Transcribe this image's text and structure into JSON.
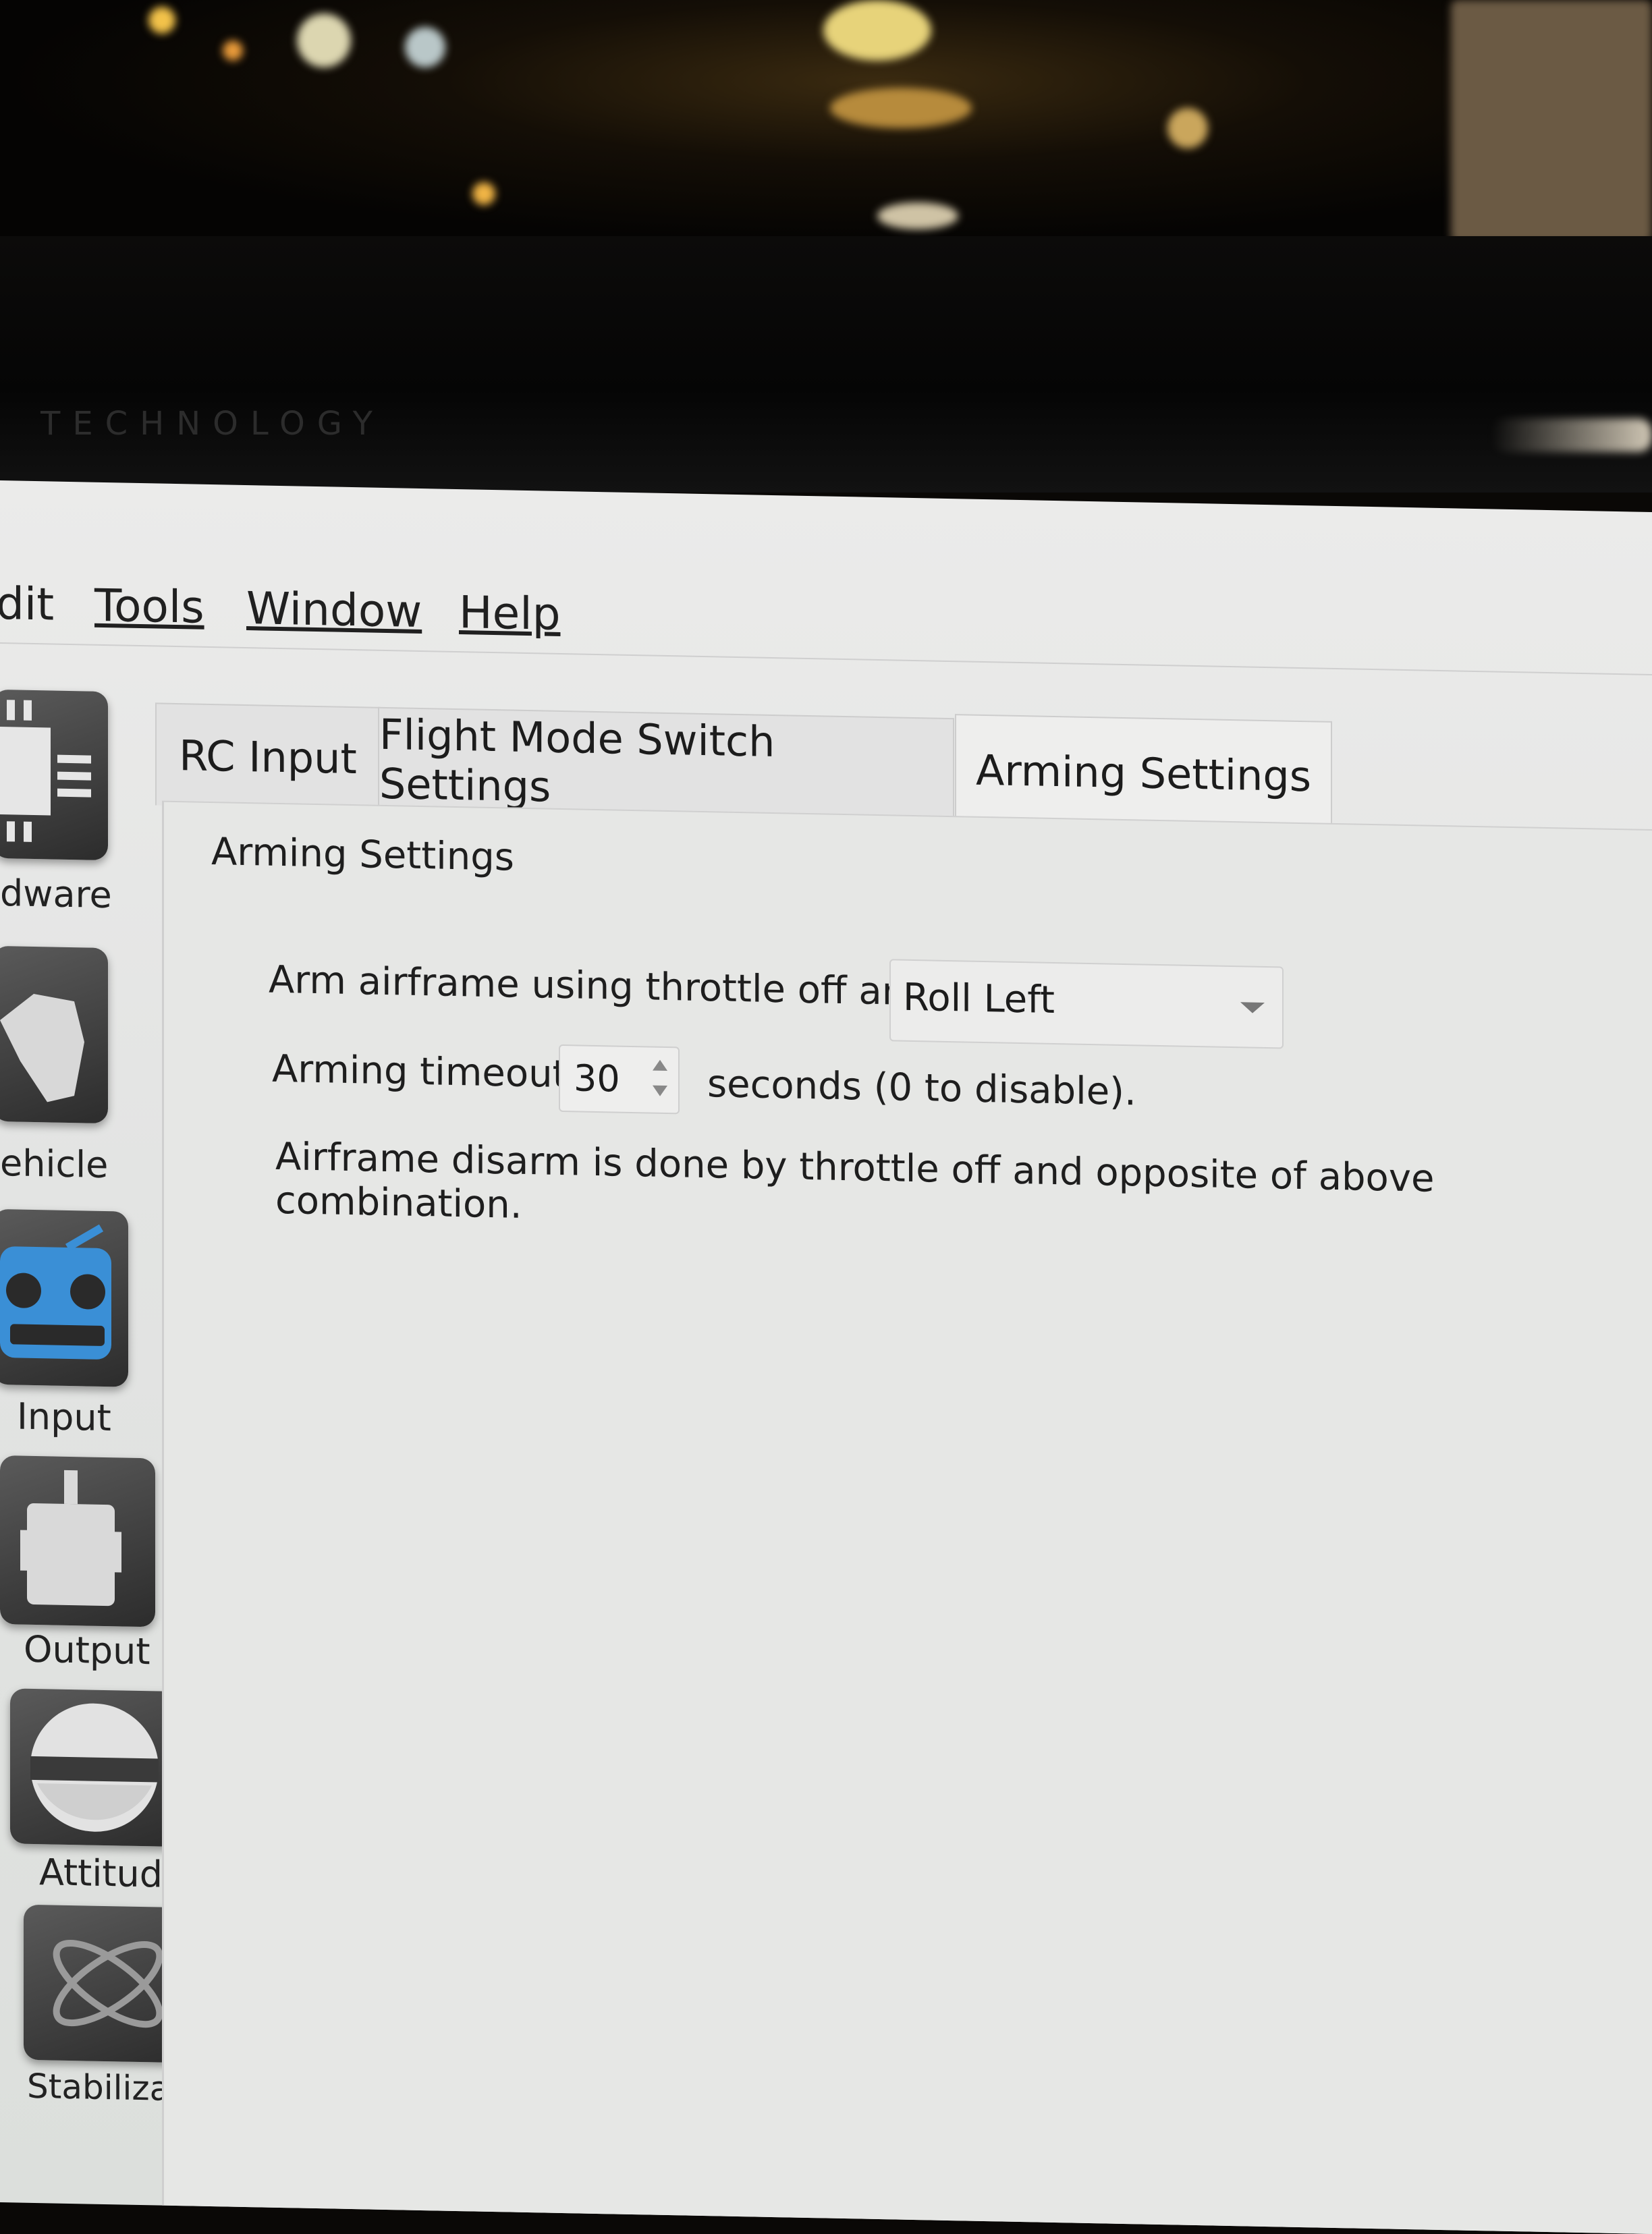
{
  "bezel": {
    "brand": "TECHNOLOGY"
  },
  "menubar": {
    "items": [
      {
        "label": "dit"
      },
      {
        "label": "Tools"
      },
      {
        "label": "Window"
      },
      {
        "label": "Help"
      }
    ]
  },
  "sidebar": {
    "items": [
      {
        "label": "dware",
        "icon": "hardware-chip-icon"
      },
      {
        "label": "ehicle",
        "icon": "vehicle-icon"
      },
      {
        "label": "Input",
        "icon": "rc-transmitter-icon"
      },
      {
        "label": "Output",
        "icon": "motor-output-icon"
      },
      {
        "label": "Attitude",
        "icon": "attitude-horizon-icon"
      },
      {
        "label": "Stabilization",
        "icon": "stabilization-gyro-icon"
      }
    ],
    "active_index": 2,
    "accent_color": "#3a8fd6"
  },
  "tabs": [
    {
      "label": "RC Input"
    },
    {
      "label": "Flight Mode Switch Settings"
    },
    {
      "label": "Arming Settings"
    }
  ],
  "active_tab": 2,
  "arming": {
    "group_title": "Arming Settings",
    "arm_label": "Arm airframe using throttle off and:",
    "arm_value": "Roll Left",
    "timeout_label": "Arming timeout:",
    "timeout_value": "30",
    "timeout_suffix": "seconds (0 to disable).",
    "disarm_note": "Airframe disarm is done by throttle off and opposite of above combination."
  }
}
